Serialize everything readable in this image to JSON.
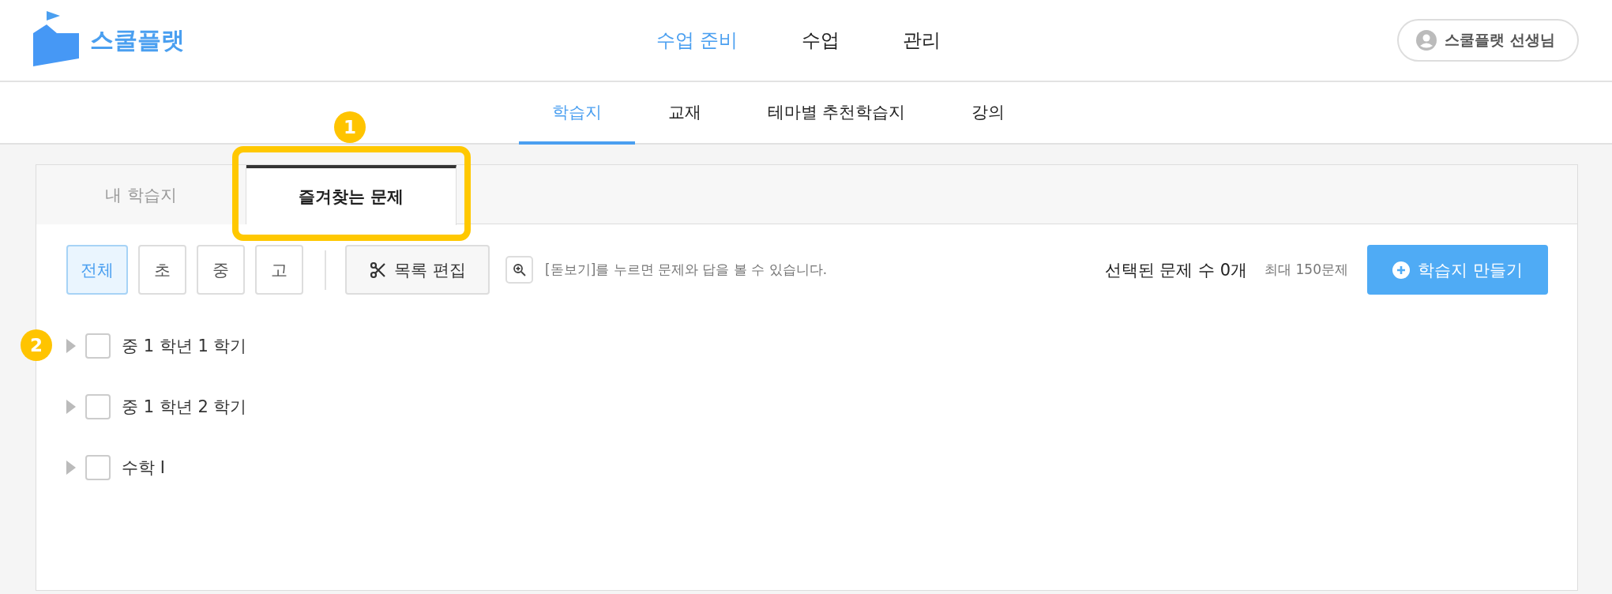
{
  "brand": {
    "name": "스쿨플랫"
  },
  "main_nav": [
    {
      "label": "수업 준비",
      "selected": true
    },
    {
      "label": "수업",
      "selected": false
    },
    {
      "label": "관리",
      "selected": false
    }
  ],
  "user": {
    "name": "스쿨플랫 선생님"
  },
  "sub_nav": [
    {
      "label": "학습지",
      "selected": true
    },
    {
      "label": "교재",
      "selected": false
    },
    {
      "label": "테마별 추천학습지",
      "selected": false
    },
    {
      "label": "강의",
      "selected": false
    }
  ],
  "tabs": [
    {
      "label": "내 학습지",
      "selected": false,
      "highlighted": false
    },
    {
      "label": "즐겨찾는 문제",
      "selected": true,
      "highlighted": true,
      "badge": "1"
    }
  ],
  "filters": [
    {
      "label": "전체",
      "selected": true
    },
    {
      "label": "초",
      "selected": false
    },
    {
      "label": "중",
      "selected": false
    },
    {
      "label": "고",
      "selected": false
    }
  ],
  "edit_button": {
    "label": "목록 편집"
  },
  "hint": "[돋보기]를 누르면 문제와 답을 볼 수 있습니다.",
  "selected_count": "선택된 문제 수 0개",
  "max_count": "최대 150문제",
  "create_button": {
    "label": "학습지 만들기"
  },
  "folders": [
    {
      "label": "중 1 학년 1 학기",
      "checked": false,
      "expanded": false,
      "badge": "2"
    },
    {
      "label": "중 1 학년 2 학기",
      "checked": false,
      "expanded": false
    },
    {
      "label": "수학 I",
      "checked": false,
      "expanded": false
    }
  ]
}
